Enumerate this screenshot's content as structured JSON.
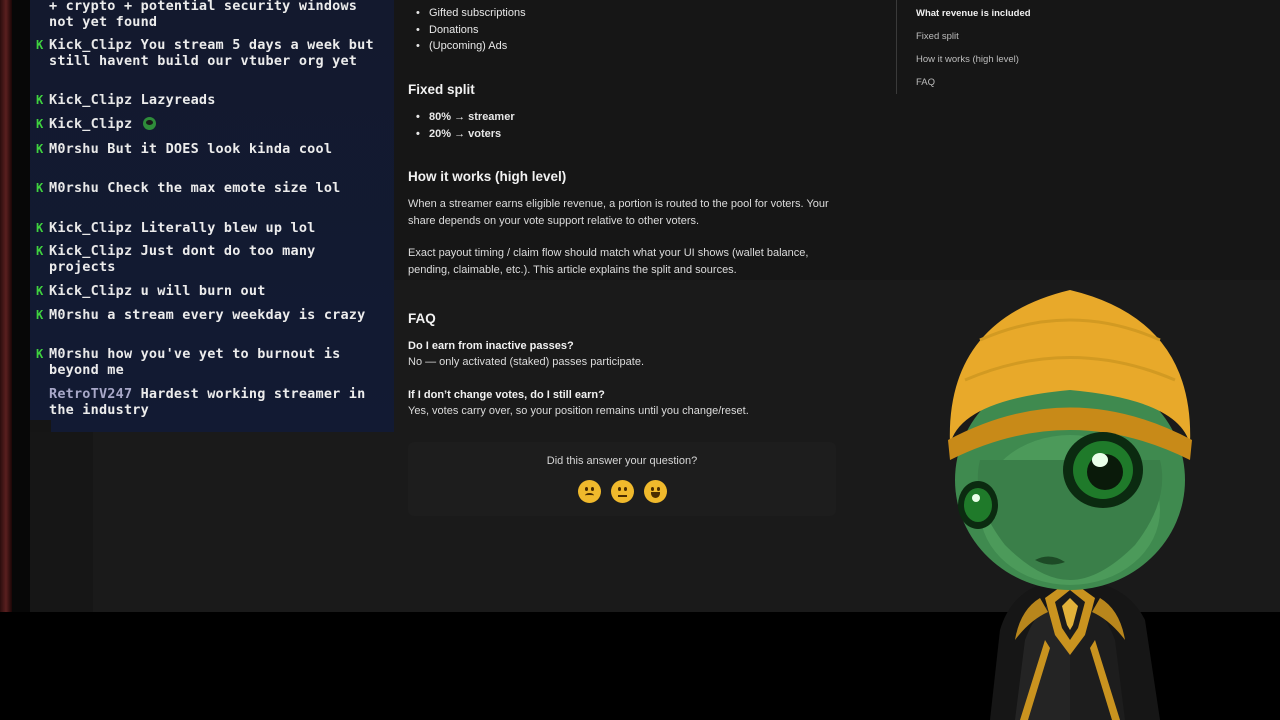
{
  "article": {
    "sources_partial": [
      "Gifted subscriptions",
      "Donations",
      "(Upcoming) Ads"
    ],
    "split_heading": "Fixed split",
    "split_items": [
      "80% → streamer",
      "20% → voters"
    ],
    "how_heading": "How it works (high level)",
    "how_para1": "When a streamer earns eligible revenue, a portion is routed to the pool for voters. Your share depends on your vote support relative to other voters.",
    "how_para2": "Exact payout timing / claim flow should match what your UI shows (wallet balance, pending, claimable, etc.). This article explains the split and sources.",
    "faq_heading": "FAQ",
    "faq": [
      {
        "q": "Do I earn from inactive passes?",
        "a": "No — only activated (staked) passes participate."
      },
      {
        "q": "If I don’t change votes, do I still earn?",
        "a": "Yes, votes carry over, so your position remains until you change/reset."
      }
    ]
  },
  "feedback": {
    "question": "Did this answer your question?",
    "options": [
      "disappointed-face",
      "neutral-face",
      "smiley-face"
    ]
  },
  "toc": {
    "items": [
      "What revenue is included",
      "Fixed split",
      "How it works (high level)",
      "FAQ"
    ],
    "active_index": 0
  },
  "chat": {
    "messages": [
      {
        "user": "",
        "text": "+ crypto + potential security windows not yet found",
        "continued": true
      },
      {
        "user": "Kick_Clipz",
        "text": "You stream 5 days a week but still havent build our vtuber org yet"
      },
      {
        "user": "Kick_Clipz",
        "text": "Lazyreads"
      },
      {
        "user": "Kick_Clipz",
        "text": "",
        "emote": "frog-emote"
      },
      {
        "user": "M0rshu",
        "text": "But it DOES look kinda cool"
      },
      {
        "user": "M0rshu",
        "text": "Check the max emote size lol"
      },
      {
        "user": "Kick_Clipz",
        "text": "Literally blew up lol"
      },
      {
        "user": "Kick_Clipz",
        "text": "Just dont do too many projects"
      },
      {
        "user": "Kick_Clipz",
        "text": "u will burn out"
      },
      {
        "user": "M0rshu",
        "text": "a stream every weekday is crazy"
      },
      {
        "user": "M0rshu",
        "text": "how you've yet to burnout is beyond me"
      },
      {
        "user": "RetroTV247",
        "text": "Hardest working streamer in the industry"
      }
    ],
    "badge_color": "#3fd13f"
  },
  "colors": {
    "page_bg": "#161616",
    "chat_bg": "#13192e",
    "emoji": "#f0b92c",
    "avatar_skin": "#3f8a4f",
    "avatar_beanie": "#e8a92a"
  }
}
